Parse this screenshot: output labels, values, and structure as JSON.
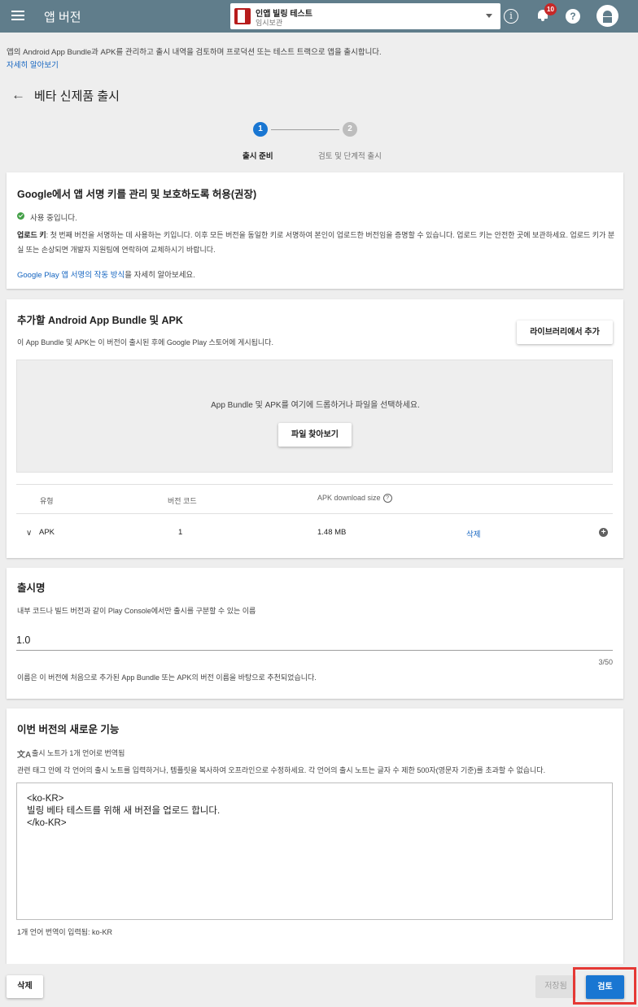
{
  "topbar": {
    "title": "앱 버전",
    "app_name": "인앱 빌링 테스트",
    "app_status": "임시보관",
    "info_glyph": "i",
    "notifications_count": "10",
    "help_glyph": "?"
  },
  "intro": {
    "description": "앱의 Android App Bundle과 APK를 관리하고 출시 내역을 검토하며 프로덕션 또는 테스트 트랙으로 앱을 출시합니다.",
    "learn_more": "자세히 알아보기"
  },
  "page": {
    "back_glyph": "←",
    "title": "베타 신제품 출시"
  },
  "stepper": {
    "step1_number": "1",
    "step1_label": "출시 준비",
    "step2_number": "2",
    "step2_label": "검토 및 단계적 출시"
  },
  "signing": {
    "title": "Google에서 앱 서명 키를 관리 및 보호하도록 허용(권장)",
    "status": "사용 중입니다.",
    "upload_key_label": "업로드 키",
    "upload_key_text": ": 첫 번째 버전을 서명하는 데 사용하는 키입니다. 이후 모든 버전을 동일한 키로 서명하여 본인이 업로드한 버전임을 증명할 수 있습니다. 업로드 키는 안전한 곳에 보관하세요. 업로드 키가 분실 또는 손상되면 개발자 지원팀에 연락하여 교체하시기 바랍니다.",
    "learn_link": "Google Play 앱 서명의 작동 방식",
    "learn_suffix": "을 자세히 알아보세요."
  },
  "bundles": {
    "title": "추가할 Android App Bundle 및 APK",
    "subtitle": "이 App Bundle 및 APK는 이 버전이 출시된 후에 Google Play 스토어에 게시됩니다.",
    "library_button": "라이브러리에서 추가",
    "drop_text": "App Bundle 및 APK를 여기에 드롭하거나 파일을 선택하세요.",
    "browse_button": "파일 찾아보기",
    "columns": [
      "유형",
      "버전 코드",
      "APK download size"
    ],
    "help_glyph": "?",
    "rows": [
      {
        "type": "APK",
        "version_code": "1",
        "size": "1.48 MB",
        "action": "삭제"
      }
    ],
    "chevron_glyph": "∨",
    "plus_glyph": "+"
  },
  "release_name": {
    "title": "출시명",
    "subtitle": "내부 코드나 빌드 버전과 같이 Play Console에서만 출시를 구분할 수 있는 이름",
    "value": "1.0",
    "counter": "3/50",
    "hint": "이름은 이 버전에 처음으로 추가된 App Bundle 또는 APK의 버전 이름을 바탕으로 추천되었습니다."
  },
  "whats_new": {
    "title": "이번 버전의 새로운 기능",
    "translate_glyph": "文A",
    "translated": "출시 노트가 1개 언어로 번역됨",
    "instructions": "관련 태그 안에 각 언어의 출시 노트를 입력하거나, 템플릿을 복사하여 오프라인으로 수정하세요. 각 언어의 출시 노트는 글자 수 제한 500자(영문자 기준)를 초과할 수 없습니다.",
    "notes": "<ko-KR>\n빌링 베타 테스트를 위해 새 버전을 업로드 합니다.\n</ko-KR>",
    "languages_entered": "1개 언어 번역이 입력됨: ko-KR"
  },
  "footer": {
    "delete_button": "삭제",
    "save_button": "저장됨",
    "review_button": "검토"
  },
  "colors": {
    "topbar": "#607d8b",
    "primary": "#1976d2",
    "link": "#1565c0",
    "success": "#43a047",
    "badge": "#c62828",
    "highlight": "#e53935"
  }
}
